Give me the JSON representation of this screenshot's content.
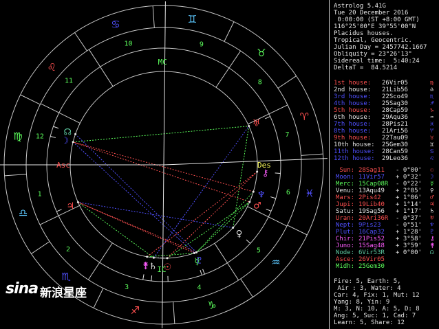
{
  "header": [
    "Astrolog 5.41G",
    "Tue 20 December 2016",
    " 0:00:00 (ST +8:00 GMT)",
    "116°25'00\"E 39°55'00\"N",
    "Placidus houses.",
    "Tropical, Geocentric.",
    "Julian Day = 2457742.1667",
    "Obliquity = 23°26'13\"",
    "Sidereal time:  5:40:24",
    "DeltaT =  84.5214"
  ],
  "houses": [
    {
      "label": "1st house:",
      "value": "26Vir05",
      "glyph": "♍",
      "color": "#ff5050"
    },
    {
      "label": "2nd house:",
      "value": "21Lib56",
      "glyph": "♎",
      "color": "#e6e6e6"
    },
    {
      "label": "3rd house:",
      "value": "22Sco49",
      "glyph": "♏",
      "color": "#5050ff"
    },
    {
      "label": "4th house:",
      "value": "25Sag30",
      "glyph": "♐",
      "color": "#5050ff"
    },
    {
      "label": "5th house:",
      "value": "28Cap59",
      "glyph": "♑",
      "color": "#ff5050"
    },
    {
      "label": "6th house:",
      "value": "29Aqu36",
      "glyph": "♒",
      "color": "#e6e6e6"
    },
    {
      "label": "7th house:",
      "value": "28Pis21",
      "glyph": "♓",
      "color": "#5050ff"
    },
    {
      "label": "8th house:",
      "value": "21Ari56",
      "glyph": "♈",
      "color": "#5050ff"
    },
    {
      "label": "9th house:",
      "value": "22Tau09",
      "glyph": "♉",
      "color": "#ff5050"
    },
    {
      "label": "10th house:",
      "value": "25Gem30",
      "glyph": "♊",
      "color": "#e6e6e6"
    },
    {
      "label": "11th house:",
      "value": "28Can59",
      "glyph": "♋",
      "color": "#5050ff"
    },
    {
      "label": "12th house:",
      "value": "29Leo36",
      "glyph": "♌",
      "color": "#5050ff"
    }
  ],
  "planets": [
    {
      "name": "Sun:",
      "pos": "28Sag11",
      "speed": "- 0°00'",
      "glyph": "☉",
      "color": "#ff5050"
    },
    {
      "name": "Moon:",
      "pos": "11Vir57",
      "speed": "+ 0°32'",
      "glyph": "☽",
      "color": "#5050ff"
    },
    {
      "name": "Merc:",
      "pos": "15Cap08R",
      "speed": "- 0°22'",
      "glyph": "☿",
      "color": "#5cff5c"
    },
    {
      "name": "Venu:",
      "pos": "13Aqu49",
      "speed": "+ 2°05'",
      "glyph": "♀",
      "color": "#e6e6e6"
    },
    {
      "name": "Mars:",
      "pos": "2Pis42",
      "speed": "+ 1°06'",
      "glyph": "♂",
      "color": "#ff5050"
    },
    {
      "name": "Jupi:",
      "pos": "19Lib40",
      "speed": "+ 1°14'",
      "glyph": "♃",
      "color": "#ff5050"
    },
    {
      "name": "Satu:",
      "pos": "19Sag56",
      "speed": "+ 1°17'",
      "glyph": "♄",
      "color": "#e6e6e6"
    },
    {
      "name": "Uran:",
      "pos": "20Ari36R",
      "speed": "- 0°37'",
      "glyph": "♅",
      "color": "#ff5050"
    },
    {
      "name": "Nept:",
      "pos": "9Pis23",
      "speed": "- 0°51'",
      "glyph": "♆",
      "color": "#5050ff"
    },
    {
      "name": "Plut:",
      "pos": "16Cap32",
      "speed": "+ 1°28'",
      "glyph": "♇",
      "color": "#5050ff"
    },
    {
      "name": "Chir:",
      "pos": "21Pis52",
      "speed": "+ 3°58'",
      "glyph": "⚷",
      "color": "#ff5cff"
    },
    {
      "name": "Juno:",
      "pos": "15Sag48",
      "speed": "+ 3°59'",
      "glyph": "⚵",
      "color": "#ff5cff"
    },
    {
      "name": "Node:",
      "pos": "6Vir53R",
      "speed": "+ 0°00'",
      "glyph": "☊",
      "color": "#5cc8a0"
    },
    {
      "name": "Asce:",
      "pos": "26Vir05",
      "speed": "",
      "glyph": "",
      "color": "#ff5050"
    },
    {
      "name": "Midh:",
      "pos": "25Gem30",
      "speed": "",
      "glyph": "",
      "color": "#5cff5c"
    }
  ],
  "summary": [
    "Fire: 5, Earth: 5,",
    " Air : 3, Water: 4",
    "Car: 4, Fix: 1, Mut: 12",
    "Yang: 8, Yin: 9",
    "M: 3, N: 10, A: 5, D: 8",
    "Ang: 5, Suc: 1, Cad: 7",
    "Learn: 5, Share: 12"
  ],
  "watermark": {
    "logo": "sina",
    "text": "新浪星座"
  },
  "colors": {
    "red": "#ff5050",
    "blue": "#5050ff",
    "green": "#5cff5c",
    "white": "#e6e6e6",
    "magenta": "#ff5cff",
    "yellow": "#ffff5c",
    "cyan": "#5cc8ff",
    "ring": "#c8c8c8"
  },
  "chart": {
    "asc_label": "Asc",
    "desc_label": "Des",
    "mc_label": "MC",
    "ic_label": "IC",
    "house_numbers": [
      "1",
      "2",
      "3",
      "4",
      "5",
      "6",
      "7",
      "8",
      "9",
      "10",
      "11",
      "12"
    ],
    "signs": [
      {
        "glyph": "♈",
        "color": "#ff5050"
      },
      {
        "glyph": "♉",
        "color": "#5cff5c"
      },
      {
        "glyph": "♊",
        "color": "#5cc8ff"
      },
      {
        "glyph": "♋",
        "color": "#5050ff"
      },
      {
        "glyph": "♌",
        "color": "#ff5050"
      },
      {
        "glyph": "♍",
        "color": "#5cff5c"
      },
      {
        "glyph": "♎",
        "color": "#5cc8ff"
      },
      {
        "glyph": "♏",
        "color": "#5050ff"
      },
      {
        "glyph": "♐",
        "color": "#ff5050"
      },
      {
        "glyph": "♑",
        "color": "#5cff5c"
      },
      {
        "glyph": "♒",
        "color": "#5cc8ff"
      },
      {
        "glyph": "♓",
        "color": "#5050ff"
      }
    ],
    "chart_planets": [
      {
        "name": "Sun",
        "lon": 268.18
      },
      {
        "name": "Moon",
        "lon": 161.95
      },
      {
        "name": "Merc",
        "lon": 285.13
      },
      {
        "name": "Venu",
        "lon": 313.82
      },
      {
        "name": "Mars",
        "lon": 332.7
      },
      {
        "name": "Jupi",
        "lon": 199.67
      },
      {
        "name": "Satu",
        "lon": 259.93
      },
      {
        "name": "Uran",
        "lon": 20.6
      },
      {
        "name": "Nept",
        "lon": 339.38
      },
      {
        "name": "Plut",
        "lon": 286.53
      },
      {
        "name": "Chir",
        "lon": 351.87
      },
      {
        "name": "Juno",
        "lon": 255.8
      },
      {
        "name": "Node",
        "lon": 156.88
      }
    ]
  }
}
